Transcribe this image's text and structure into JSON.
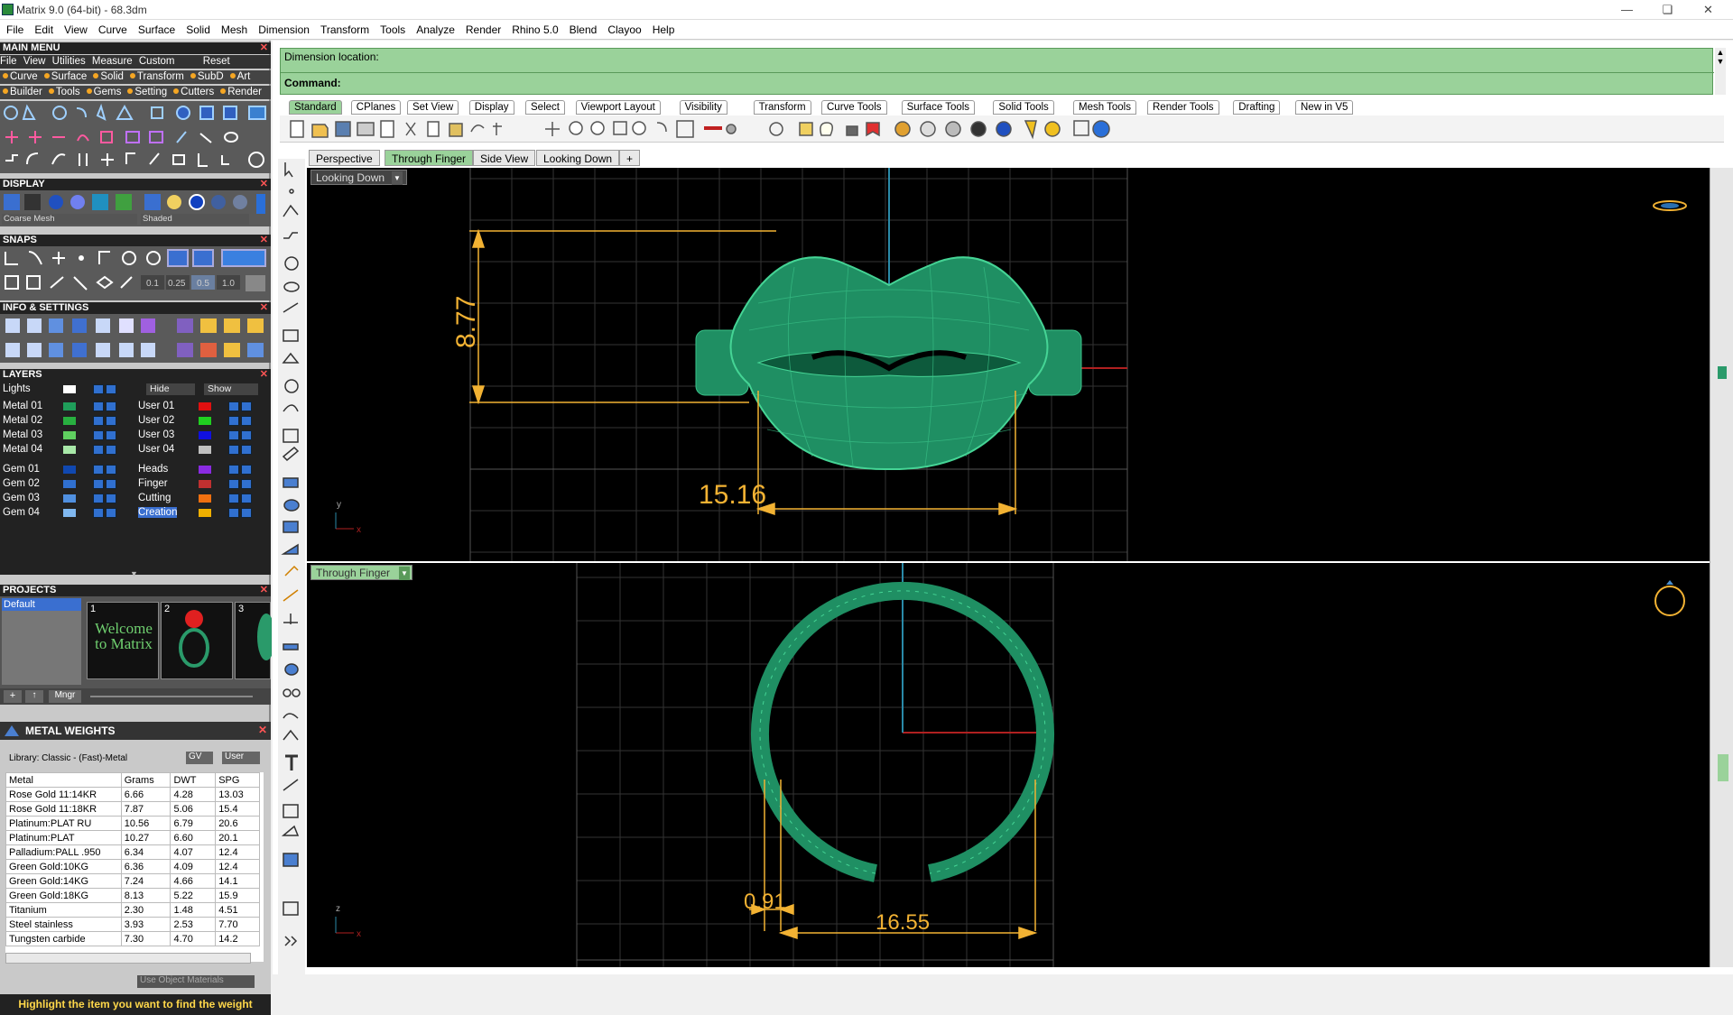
{
  "app": {
    "title": "Matrix 9.0 (64-bit) - 68.3dm"
  },
  "menu": [
    "File",
    "Edit",
    "View",
    "Curve",
    "Surface",
    "Solid",
    "Mesh",
    "Dimension",
    "Transform",
    "Tools",
    "Analyze",
    "Render",
    "Rhino 5.0",
    "Blend",
    "Clayoo",
    "Help"
  ],
  "left": {
    "main_menu": "MAIN MENU",
    "main_menu_row": [
      "File",
      "View",
      "Utilities",
      "Measure",
      "Custom",
      "Reset"
    ],
    "cat_row1": [
      "Curve",
      "Surface",
      "Solid",
      "Transform",
      "SubD",
      "Art"
    ],
    "cat_row2": [
      "Builder",
      "Tools",
      "Gems",
      "Setting",
      "Cutters",
      "Render"
    ],
    "display": "DISPLAY",
    "display_mesh": "Coarse Mesh",
    "display_mode": "Shaded",
    "snaps": "SNAPS",
    "snap_values": [
      "0.1",
      "0.25",
      "0.5",
      "1.0"
    ],
    "info": "INFO & SETTINGS",
    "layers": "LAYERS",
    "lights": "Lights",
    "hide": "Hide",
    "show": "Show",
    "layers_left": [
      {
        "name": "Metal 01",
        "color": "#1f9e5a"
      },
      {
        "name": "Metal 02",
        "color": "#28b040"
      },
      {
        "name": "Metal 03",
        "color": "#60d060"
      },
      {
        "name": "Metal 04",
        "color": "#a8e8a8"
      },
      {
        "name": "Gem 01",
        "color": "#1048b0"
      },
      {
        "name": "Gem 02",
        "color": "#3070d0"
      },
      {
        "name": "Gem 03",
        "color": "#5090e0"
      },
      {
        "name": "Gem 04",
        "color": "#80b8f0"
      }
    ],
    "layers_right": [
      {
        "name": "User 01",
        "color": "#e01010"
      },
      {
        "name": "User 02",
        "color": "#20d020"
      },
      {
        "name": "User 03",
        "color": "#1010e0"
      },
      {
        "name": "User 04",
        "color": "#c0c0c0"
      },
      {
        "name": "Heads",
        "color": "#8a2be2"
      },
      {
        "name": "Finger",
        "color": "#c03030"
      },
      {
        "name": "Cutting",
        "color": "#f07010"
      },
      {
        "name": "Creation",
        "color": "#f0b000"
      }
    ],
    "projects": "PROJECTS",
    "project_default": "Default",
    "project_nums": [
      "1",
      "2",
      "3"
    ],
    "welcome": "Welcome to Matrix",
    "mngr": "Mngr",
    "metal_weights": "METAL WEIGHTS",
    "library": "Library: Classic - (Fast)-Metal",
    "gv": "GV",
    "user": "User",
    "mw_headers": [
      "Metal",
      "Grams",
      "DWT",
      "SPG"
    ],
    "mw_rows": [
      [
        "Rose Gold 11:14KR",
        "6.66",
        "4.28",
        "13.03"
      ],
      [
        "Rose Gold 11:18KR",
        "7.87",
        "5.06",
        "15.4"
      ],
      [
        "Platinum:PLAT RU",
        "10.56",
        "6.79",
        "20.6"
      ],
      [
        "Platinum:PLAT",
        "10.27",
        "6.60",
        "20.1"
      ],
      [
        "Palladium:PALL .950",
        "6.34",
        "4.07",
        "12.4"
      ],
      [
        "Green Gold:10KG",
        "6.36",
        "4.09",
        "12.4"
      ],
      [
        "Green Gold:14KG",
        "7.24",
        "4.66",
        "14.1"
      ],
      [
        "Green Gold:18KG",
        "8.13",
        "5.22",
        "15.9"
      ],
      [
        "Titanium",
        "2.30",
        "1.48",
        "4.51"
      ],
      [
        "Steel stainless",
        "3.93",
        "2.53",
        "7.70"
      ],
      [
        "Tungsten carbide",
        "7.30",
        "4.70",
        "14.2"
      ]
    ],
    "use_obj": "Use Object Materials",
    "hint": "Highlight the item you want to find the weight"
  },
  "command": {
    "dimension": "Dimension location:",
    "command": "Command:"
  },
  "toolbar_tabs": [
    "Standard",
    "CPlanes",
    "Set View",
    "Display",
    "Select",
    "Viewport Layout",
    "Visibility",
    "Transform",
    "Curve Tools",
    "Surface Tools",
    "Solid Tools",
    "Mesh Tools",
    "Render Tools",
    "Drafting",
    "New in V5"
  ],
  "view_tabs": [
    "Perspective",
    "Through Finger",
    "Side View",
    "Looking Down"
  ],
  "vp1": {
    "label": "Looking Down",
    "dim_h": "15.16",
    "dim_v": "8.77",
    "axis_y": "y",
    "axis_x": "x"
  },
  "vp2": {
    "label": "Through Finger",
    "dim_gap": "0.91",
    "dim_w": "16.55",
    "axis_z": "z",
    "axis_x": "x"
  },
  "colors": {
    "cmd_green": "#9ad29a",
    "ring_green": "#1f8f63",
    "dim": "#f2b233",
    "grid": "#3a3a3a"
  }
}
